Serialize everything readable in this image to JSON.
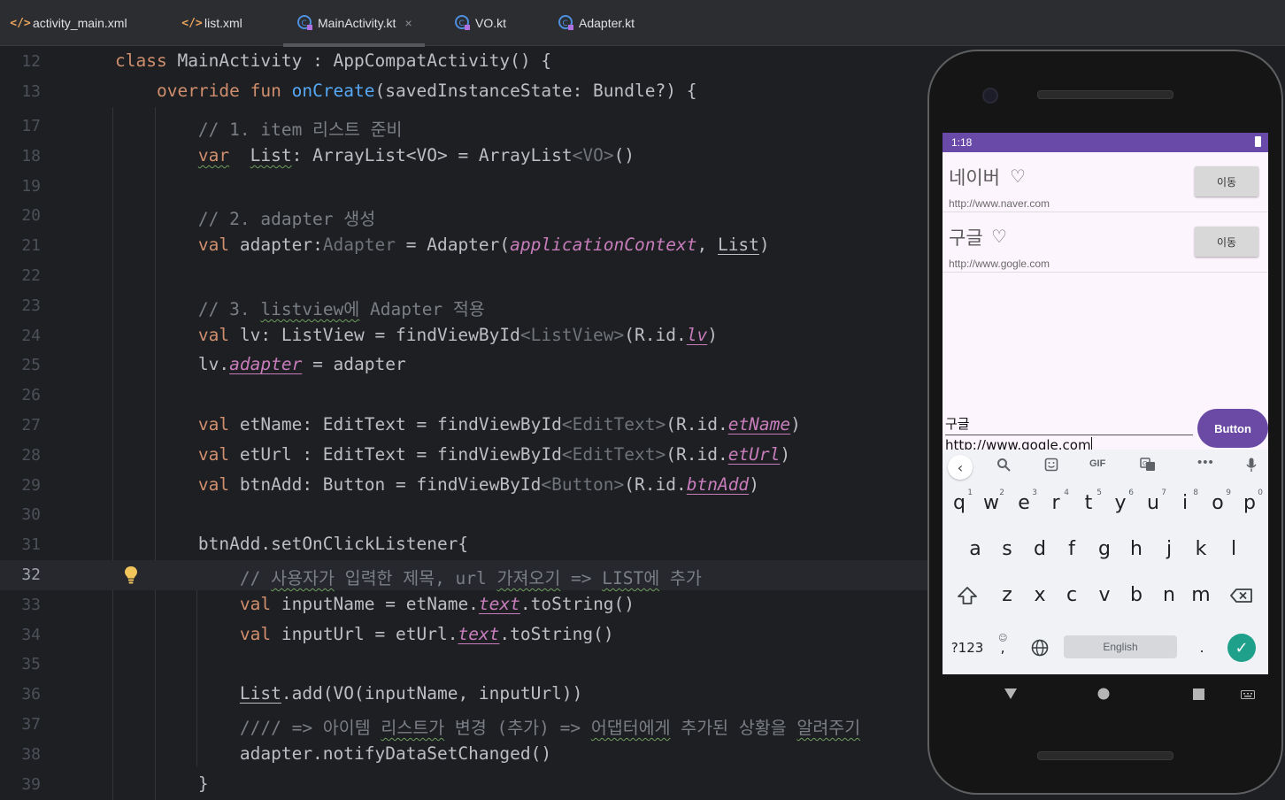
{
  "tabs": [
    {
      "label": "activity_main.xml",
      "icon": "xml-icon"
    },
    {
      "label": "list.xml",
      "icon": "xml-icon"
    },
    {
      "label": "MainActivity.kt",
      "icon": "kotlin-class-icon",
      "active": true
    },
    {
      "label": "VO.kt",
      "icon": "kotlin-class-icon"
    },
    {
      "label": "Adapter.kt",
      "icon": "kotlin-class-icon"
    }
  ],
  "tab_close_glyph": "×",
  "editor": {
    "current_line": "32",
    "lines": [
      {
        "n": "12",
        "t": [
          [
            "kw",
            "class "
          ],
          [
            "",
            "MainActivity : AppCompatActivity() {"
          ]
        ]
      },
      {
        "n": "13",
        "t": [
          [
            "",
            "    "
          ],
          [
            "kw",
            "override fun "
          ],
          [
            "fn",
            "onCreate"
          ],
          [
            "",
            "(savedInstanceState: Bundle?) {"
          ]
        ]
      },
      {
        "n": "17",
        "t": [
          [
            "",
            "        "
          ],
          [
            "cm",
            "// 1. item 리스트 준비"
          ]
        ]
      },
      {
        "n": "18",
        "t": [
          [
            "",
            "        "
          ],
          [
            "kw wv",
            "var"
          ],
          [
            "",
            "  "
          ],
          [
            "ul wv",
            "List"
          ],
          [
            "",
            ": ArrayList<VO> = ArrayList"
          ],
          [
            "ty",
            "<VO>"
          ],
          [
            "",
            "()"
          ]
        ]
      },
      {
        "n": "19",
        "t": []
      },
      {
        "n": "20",
        "t": [
          [
            "",
            "        "
          ],
          [
            "cm",
            "// 2. adapter 생성"
          ]
        ]
      },
      {
        "n": "21",
        "t": [
          [
            "",
            "        "
          ],
          [
            "kw",
            "val "
          ],
          [
            "",
            "adapter:"
          ],
          [
            "ty",
            "Adapter"
          ],
          [
            "",
            " = Adapter("
          ],
          [
            "pr",
            "applicationContext"
          ],
          [
            "",
            ", "
          ],
          [
            "ul",
            "List"
          ],
          [
            "",
            ")"
          ]
        ]
      },
      {
        "n": "22",
        "t": []
      },
      {
        "n": "23",
        "t": [
          [
            "",
            "        "
          ],
          [
            "cm",
            "// 3. "
          ],
          [
            "cm wv",
            "listview에"
          ],
          [
            "cm",
            " Adapter 적용"
          ]
        ]
      },
      {
        "n": "24",
        "t": [
          [
            "",
            "        "
          ],
          [
            "kw",
            "val "
          ],
          [
            "",
            "lv: ListView = findViewById"
          ],
          [
            "ty",
            "<ListView>"
          ],
          [
            "",
            "(R.id."
          ],
          [
            "pr ul",
            "lv"
          ],
          [
            "",
            ")"
          ]
        ]
      },
      {
        "n": "25",
        "t": [
          [
            "",
            "        lv."
          ],
          [
            "pr ul",
            "adapter"
          ],
          [
            "",
            " = adapter"
          ]
        ]
      },
      {
        "n": "26",
        "t": []
      },
      {
        "n": "27",
        "t": [
          [
            "",
            "        "
          ],
          [
            "kw",
            "val "
          ],
          [
            "",
            "etName: EditText = findViewById"
          ],
          [
            "ty",
            "<EditText>"
          ],
          [
            "",
            "(R.id."
          ],
          [
            "pr ul",
            "etName"
          ],
          [
            "",
            ")"
          ]
        ]
      },
      {
        "n": "28",
        "t": [
          [
            "",
            "        "
          ],
          [
            "kw",
            "val "
          ],
          [
            "",
            "etUrl : EditText = findViewById"
          ],
          [
            "ty",
            "<EditText>"
          ],
          [
            "",
            "(R.id."
          ],
          [
            "pr ul",
            "etUrl"
          ],
          [
            "",
            ")"
          ]
        ]
      },
      {
        "n": "29",
        "t": [
          [
            "",
            "        "
          ],
          [
            "kw",
            "val "
          ],
          [
            "",
            "btnAdd: Button = findViewById"
          ],
          [
            "ty",
            "<Button>"
          ],
          [
            "",
            "(R.id."
          ],
          [
            "pr ul",
            "btnAdd"
          ],
          [
            "",
            ")"
          ]
        ]
      },
      {
        "n": "30",
        "t": []
      },
      {
        "n": "31",
        "t": [
          [
            "",
            "        btnAdd.setOnClickListener{"
          ]
        ]
      },
      {
        "n": "32",
        "t": [
          [
            "",
            "            "
          ],
          [
            "cm",
            "// "
          ],
          [
            "cm wv",
            "사용자가"
          ],
          [
            "cm",
            " 입력한 제목, url "
          ],
          [
            "cm wv",
            "가져오기"
          ],
          [
            "cm",
            " => "
          ],
          [
            "cm wv",
            "LIST에"
          ],
          [
            "cm",
            " 추가"
          ]
        ]
      },
      {
        "n": "33",
        "t": [
          [
            "",
            "            "
          ],
          [
            "kw",
            "val "
          ],
          [
            "",
            "inputName = etName."
          ],
          [
            "pr ul",
            "text"
          ],
          [
            "",
            ".toString()"
          ]
        ]
      },
      {
        "n": "34",
        "t": [
          [
            "",
            "            "
          ],
          [
            "kw",
            "val "
          ],
          [
            "",
            "inputUrl = etUrl."
          ],
          [
            "pr ul",
            "text"
          ],
          [
            "",
            ".toString()"
          ]
        ]
      },
      {
        "n": "35",
        "t": []
      },
      {
        "n": "36",
        "t": [
          [
            "",
            "            "
          ],
          [
            "ul",
            "List"
          ],
          [
            "",
            ".add(VO(inputName, inputUrl))"
          ]
        ]
      },
      {
        "n": "37",
        "t": [
          [
            "",
            "            "
          ],
          [
            "cm",
            "//// => 아이템 "
          ],
          [
            "cm wv",
            "리스트가"
          ],
          [
            "cm",
            " 변경 (추가) => "
          ],
          [
            "cm wv",
            "어댑터에게"
          ],
          [
            "cm",
            " 추가된 상황을 "
          ],
          [
            "cm wv",
            "알려주기"
          ]
        ]
      },
      {
        "n": "38",
        "t": [
          [
            "",
            "            adapter.notifyDataSetChanged()"
          ]
        ]
      },
      {
        "n": "39",
        "t": [
          [
            "",
            "        }"
          ]
        ]
      }
    ]
  },
  "phone": {
    "status_time": "1:18",
    "list": [
      {
        "name": "네이버",
        "heart": "♡",
        "url": "http://www.naver.com",
        "button": "이동"
      },
      {
        "name": "구글",
        "heart": "♡",
        "url": "http://www.gogle.com",
        "button": "이동"
      }
    ],
    "et_name": "구글",
    "et_url": "http://www.gogle.com",
    "add_button": "Button",
    "keyboard": {
      "gif": "GIF",
      "row1": [
        [
          "q",
          "1"
        ],
        [
          "w",
          "2"
        ],
        [
          "e",
          "3"
        ],
        [
          "r",
          "4"
        ],
        [
          "t",
          "5"
        ],
        [
          "y",
          "6"
        ],
        [
          "u",
          "7"
        ],
        [
          "i",
          "8"
        ],
        [
          "o",
          "9"
        ],
        [
          "p",
          "0"
        ]
      ],
      "row2": [
        "a",
        "s",
        "d",
        "f",
        "g",
        "h",
        "j",
        "k",
        "l"
      ],
      "row3": [
        "z",
        "x",
        "c",
        "v",
        "b",
        "n",
        "m"
      ],
      "sym": "?123",
      "comma": ",",
      "period": ".",
      "space": "English"
    }
  }
}
